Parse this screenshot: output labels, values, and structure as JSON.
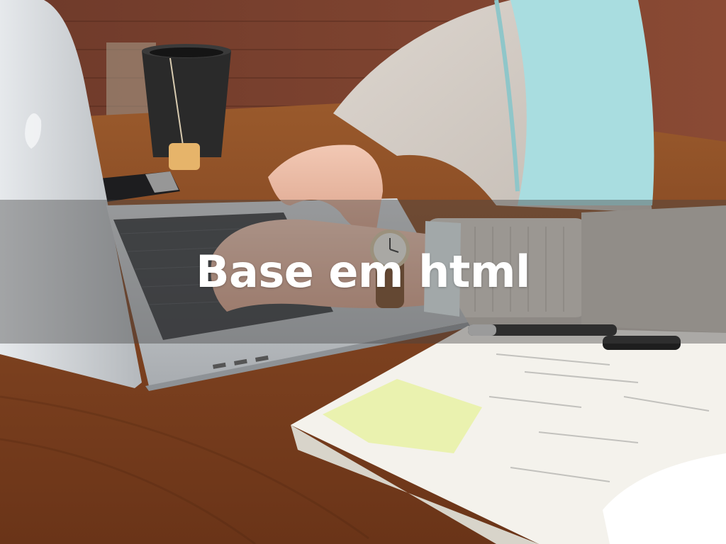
{
  "title": "Base em html",
  "colors": {
    "band_overlay": "rgba(70,70,70,0.42)",
    "title_text": "#ffffff",
    "table_wood": "#8a4a22",
    "brick_wall": "#7a3a28",
    "laptop_silver": "#c8ccd0",
    "shirt_blue": "#a9dde0",
    "cardigan": "#cfc8c0",
    "notebook": "#f4f2ec",
    "sticky_note": "#e9f2a8",
    "mug": "#2a2a2a"
  },
  "scene_objects": [
    "brick-wall",
    "wooden-table",
    "tea-mug",
    "tea-tag",
    "smartphone",
    "laptop",
    "laptop-keyboard",
    "hands",
    "wrist-watch",
    "cardigan-arm",
    "notebook",
    "sticky-note",
    "pen"
  ]
}
